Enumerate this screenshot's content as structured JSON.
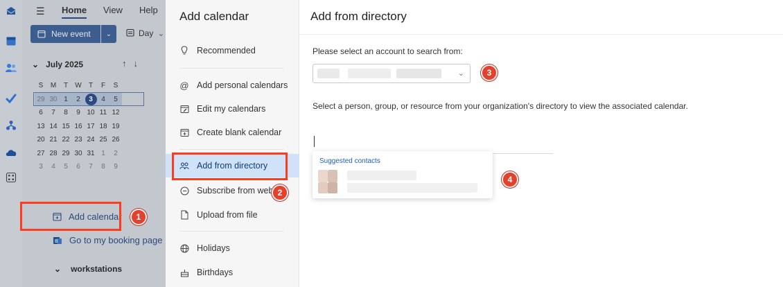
{
  "rail": {
    "icons": [
      "mail-icon",
      "calendar-icon",
      "people-icon",
      "todo-icon",
      "org-icon",
      "onedrive-icon",
      "apps-icon"
    ]
  },
  "ribbon": {
    "tabs": [
      "Home",
      "View",
      "Help"
    ],
    "new_event": "New event",
    "day_view": "Day"
  },
  "mini_calendar": {
    "month": "July 2025",
    "weekdays": [
      "S",
      "M",
      "T",
      "W",
      "T",
      "F",
      "S"
    ],
    "weeks": [
      [
        "29",
        "30",
        "1",
        "2",
        "3",
        "4",
        "5"
      ],
      [
        "6",
        "7",
        "8",
        "9",
        "10",
        "11",
        "12"
      ],
      [
        "13",
        "14",
        "15",
        "16",
        "17",
        "18",
        "19"
      ],
      [
        "20",
        "21",
        "22",
        "23",
        "24",
        "25",
        "26"
      ],
      [
        "27",
        "28",
        "29",
        "30",
        "31",
        "1",
        "2"
      ],
      [
        "3",
        "4",
        "5",
        "6",
        "7",
        "8",
        "9"
      ]
    ],
    "today": "3"
  },
  "left_links": {
    "add_calendar": "Add calendar",
    "booking": "Go to my booking page",
    "group": "workstations"
  },
  "nav": {
    "title": "Add calendar",
    "items": [
      {
        "label": "Recommended",
        "icon": "bulb-icon"
      },
      {
        "label": "Add personal calendars",
        "icon": "at-icon"
      },
      {
        "label": "Edit my calendars",
        "icon": "edit-calendar-icon"
      },
      {
        "label": "Create blank calendar",
        "icon": "blank-calendar-icon"
      },
      {
        "label": "Add from directory",
        "icon": "directory-icon"
      },
      {
        "label": "Subscribe from web",
        "icon": "subscribe-icon"
      },
      {
        "label": "Upload from file",
        "icon": "file-icon"
      },
      {
        "label": "Holidays",
        "icon": "globe-icon"
      },
      {
        "label": "Birthdays",
        "icon": "cake-icon"
      }
    ]
  },
  "directory": {
    "title": "Add from directory",
    "account_label": "Please select an account to search from:",
    "select_description": "Select a person, group, or resource from your organization's directory to view the associated calendar.",
    "suggested_label": "Suggested contacts"
  },
  "markers": [
    "1",
    "2",
    "3",
    "4"
  ],
  "colors": {
    "highlight": "#ff3b1f",
    "marker": "#e4412c",
    "selected_nav": "#cfe2f8",
    "link": "#1f5fb0"
  }
}
